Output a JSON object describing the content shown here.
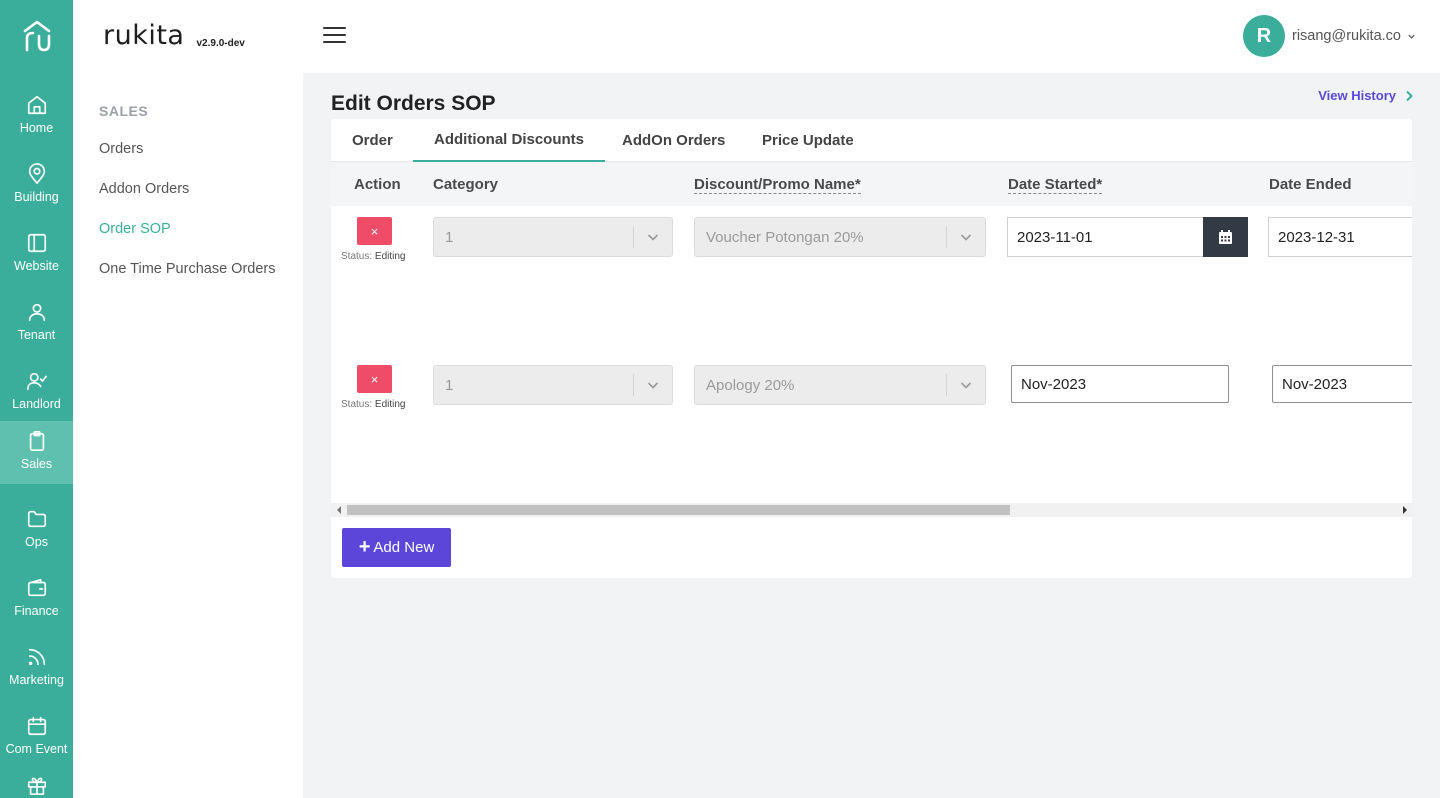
{
  "app": {
    "brand": "rukita",
    "version": "v2.9.0-dev"
  },
  "rail": {
    "items": [
      {
        "label": "Home",
        "icon": "home-icon"
      },
      {
        "label": "Building",
        "icon": "location-pin-icon"
      },
      {
        "label": "Website",
        "icon": "layout-icon"
      },
      {
        "label": "Tenant",
        "icon": "user-icon"
      },
      {
        "label": "Landlord",
        "icon": "user-check-icon"
      },
      {
        "label": "Sales",
        "icon": "clipboard-icon",
        "active": true
      },
      {
        "label": "Ops",
        "icon": "folder-icon"
      },
      {
        "label": "Finance",
        "icon": "wallet-icon"
      },
      {
        "label": "Marketing",
        "icon": "rss-icon"
      },
      {
        "label": "Com Event",
        "icon": "calendar-icon"
      },
      {
        "label": "",
        "icon": "gift-icon"
      }
    ]
  },
  "user": {
    "initial": "R",
    "email": "risang@rukita.co"
  },
  "subnav": {
    "title": "SALES",
    "items": [
      {
        "label": "Orders"
      },
      {
        "label": "Addon Orders"
      },
      {
        "label": "Order SOP",
        "active": true
      },
      {
        "label": "One Time Purchase Orders"
      }
    ]
  },
  "page": {
    "title": "Edit Orders SOP",
    "view_history": "View History"
  },
  "tabs": [
    {
      "label": "Order"
    },
    {
      "label": "Additional Discounts",
      "active": true
    },
    {
      "label": "AddOn Orders"
    },
    {
      "label": "Price Update"
    }
  ],
  "table": {
    "columns": [
      "Action",
      "Category",
      "Discount/Promo Name*",
      "Date Started*",
      "Date Ended"
    ],
    "status_prefix": "Status:",
    "rows": [
      {
        "delete": "×",
        "status": "Editing",
        "category": "1",
        "promo_name": "Voucher Potongan 20%",
        "date_started": "2023-11-01",
        "date_ended": "2023-12-31"
      },
      {
        "delete": "×",
        "status": "Editing",
        "category": "1",
        "promo_name": "Apology 20%",
        "date_started": "Nov-2023",
        "date_ended": "Nov-2023"
      }
    ]
  },
  "actions": {
    "add_new": "Add New"
  },
  "colors": {
    "accent": "#3aae9b",
    "primary_button": "#5b46d9",
    "danger": "#ef4d67",
    "link": "#5a48d6"
  }
}
